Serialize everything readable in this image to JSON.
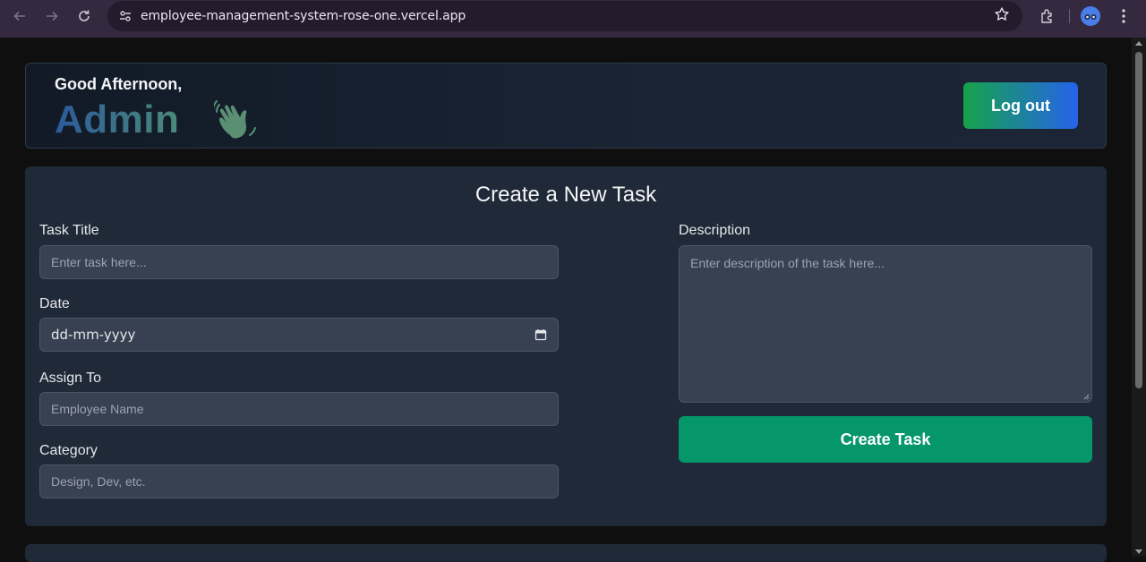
{
  "browser": {
    "url": "employee-management-system-rose-one.vercel.app",
    "icons": [
      "back-icon",
      "forward-icon",
      "reload-icon",
      "site-settings-icon",
      "bookmark-star-icon",
      "extensions-icon",
      "profile-avatar",
      "menu-icon"
    ]
  },
  "header": {
    "greeting": "Good Afternoon,",
    "name": "Admin",
    "wave_icon": "waving-hand-emoji",
    "logout_label": "Log out"
  },
  "form": {
    "title": "Create a New Task",
    "task_title": {
      "label": "Task Title",
      "placeholder": "Enter task here..."
    },
    "date": {
      "label": "Date",
      "placeholder": "dd-mm-yyyy"
    },
    "assign_to": {
      "label": "Assign To",
      "placeholder": "Employee Name"
    },
    "category": {
      "label": "Category",
      "placeholder": "Design, Dev, etc."
    },
    "description": {
      "label": "Description",
      "placeholder": "Enter description of the task here..."
    },
    "submit_label": "Create Task"
  },
  "colors": {
    "page_bg": "#0f0f0f",
    "card_bg": "#1f2937",
    "input_bg": "#374151",
    "create_button": "#059669",
    "logout_gradient_start": "#16a34a",
    "logout_gradient_end": "#2563eb"
  }
}
